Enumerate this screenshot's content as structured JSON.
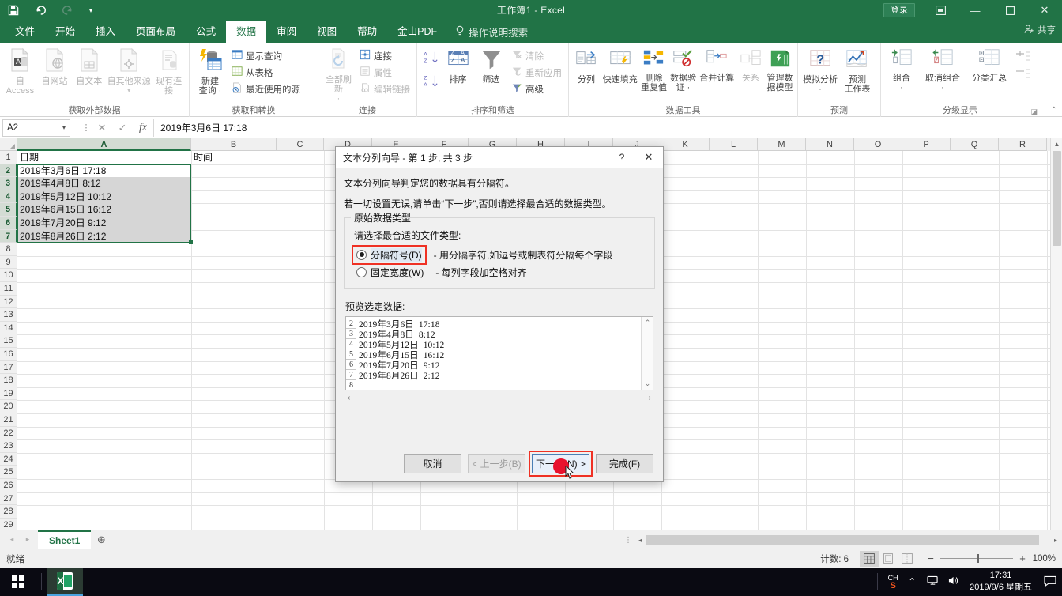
{
  "titlebar": {
    "document_title": "工作簿1  -  Excel",
    "quick_access": [
      {
        "name": "save",
        "glyph": "ὋE"
      },
      {
        "name": "undo",
        "glyph": "↶"
      },
      {
        "name": "redo",
        "glyph": "↷"
      },
      {
        "name": "customize",
        "glyph": "▾"
      }
    ],
    "sign_in_label": "登录",
    "ribbon_display_label": "⬜",
    "minimize_label": "—",
    "restore_label": "❐",
    "close_label": "✕",
    "share_label": "共享",
    "brand_color": "#217346"
  },
  "ribbon_tabs": [
    {
      "label": "文件",
      "active": false
    },
    {
      "label": "开始",
      "active": false
    },
    {
      "label": "插入",
      "active": false
    },
    {
      "label": "页面布局",
      "active": false
    },
    {
      "label": "公式",
      "active": false
    },
    {
      "label": "数据",
      "active": true
    },
    {
      "label": "审阅",
      "active": false
    },
    {
      "label": "视图",
      "active": false
    },
    {
      "label": "帮助",
      "active": false
    },
    {
      "label": "金山PDF",
      "active": false
    }
  ],
  "tell_me": "操作说明搜索",
  "ribbon_groups": [
    {
      "title": "获取外部数据",
      "big_buttons": [
        {
          "label": "自 Access",
          "icon": "access-icon",
          "disabled": true
        },
        {
          "label": "自网站",
          "icon": "web-icon",
          "disabled": true
        },
        {
          "label": "自文本",
          "icon": "text-file-icon",
          "disabled": true
        },
        {
          "label": "自其他来源",
          "icon": "other-sources-icon",
          "disabled": true
        },
        {
          "label": "现有连接",
          "icon": "existing-connections-icon",
          "disabled": true
        }
      ]
    },
    {
      "title": "获取和转换",
      "big_buttons": [
        {
          "label": "新建\n查询 ·",
          "icon": "new-query-icon",
          "disabled": false
        }
      ],
      "small_buttons": [
        {
          "label": "显示查询",
          "icon": "show-queries-icon",
          "disabled": false
        },
        {
          "label": "从表格",
          "icon": "from-table-icon",
          "disabled": false
        },
        {
          "label": "最近使用的源",
          "icon": "recent-sources-icon",
          "disabled": false
        }
      ]
    },
    {
      "title": "连接",
      "big_buttons": [
        {
          "label": "全部刷新\n·",
          "icon": "refresh-all-icon",
          "disabled": true
        }
      ],
      "small_buttons": [
        {
          "label": "连接",
          "icon": "connections-icon",
          "disabled": false
        },
        {
          "label": "属性",
          "icon": "properties-icon",
          "disabled": true
        },
        {
          "label": "编辑链接",
          "icon": "edit-links-icon",
          "disabled": true
        }
      ]
    },
    {
      "title": "排序和筛选",
      "big_buttons": [
        {
          "label": "排序",
          "icon": "sort-icon",
          "disabled": false
        },
        {
          "label": "筛选",
          "icon": "filter-icon",
          "disabled": false
        }
      ],
      "small_buttons": [
        {
          "label": "清除",
          "icon": "clear-filter-icon",
          "disabled": true
        },
        {
          "label": "重新应用",
          "icon": "reapply-icon",
          "disabled": true
        },
        {
          "label": "高级",
          "icon": "advanced-filter-icon",
          "disabled": false
        }
      ],
      "sort_az_label": "A↓Z",
      "sort_za_label": "Z↓A"
    },
    {
      "title": "数据工具",
      "big_buttons": [
        {
          "label": "分列",
          "icon": "text-to-columns-icon",
          "disabled": false
        },
        {
          "label": "快速填充",
          "icon": "flash-fill-icon",
          "disabled": false
        },
        {
          "label": "删除\n重复值",
          "icon": "remove-duplicates-icon",
          "disabled": false
        },
        {
          "label": "数据验\n证 ·",
          "icon": "data-validation-icon",
          "disabled": false
        },
        {
          "label": "合并计算",
          "icon": "consolidate-icon",
          "disabled": false
        },
        {
          "label": "关系",
          "icon": "relationships-icon",
          "disabled": true
        },
        {
          "label": "管理数\n据模型",
          "icon": "manage-data-model-icon",
          "disabled": false
        }
      ]
    },
    {
      "title": "预测",
      "big_buttons": [
        {
          "label": "模拟分析\n·",
          "icon": "what-if-analysis-icon",
          "disabled": false
        },
        {
          "label": "预测\n工作表",
          "icon": "forecast-sheet-icon",
          "disabled": false
        }
      ]
    },
    {
      "title": "分级显示",
      "big_buttons": [
        {
          "label": "组合\n·",
          "icon": "group-icon",
          "disabled": false
        },
        {
          "label": "取消组合\n·",
          "icon": "ungroup-icon",
          "disabled": false
        },
        {
          "label": "分类汇总",
          "icon": "subtotal-icon",
          "disabled": false
        }
      ]
    }
  ],
  "formula_bar": {
    "name_box_value": "A2",
    "cancel_label": "✕",
    "enter_label": "✓",
    "fx_label": "fx",
    "formula_value": "2019年3月6日 17:18"
  },
  "grid": {
    "column_headers": [
      "A",
      "B",
      "C",
      "D",
      "E",
      "F",
      "G",
      "H",
      "I",
      "J",
      "K",
      "L",
      "M",
      "N",
      "O",
      "P",
      "Q",
      "R"
    ],
    "selected_column": "A",
    "row_numbers": [
      1,
      2,
      3,
      4,
      5,
      6,
      7,
      8,
      9,
      10,
      11,
      12,
      13,
      14,
      15,
      16,
      17,
      18,
      19,
      20,
      21,
      22,
      23,
      24,
      25,
      26,
      27,
      28,
      29
    ],
    "selected_rows": [
      2,
      3,
      4,
      5,
      6,
      7
    ],
    "cells": [
      {
        "ref": "A1",
        "col": 0,
        "row": 1,
        "value": "日期",
        "shaded": false
      },
      {
        "ref": "B1",
        "col": 1,
        "row": 1,
        "value": "时间",
        "shaded": false
      },
      {
        "ref": "A2",
        "col": 0,
        "row": 2,
        "value": "2019年3月6日 17:18",
        "shaded": false
      },
      {
        "ref": "A3",
        "col": 0,
        "row": 3,
        "value": "2019年4月8日 8:12",
        "shaded": true
      },
      {
        "ref": "A4",
        "col": 0,
        "row": 4,
        "value": "2019年5月12日 10:12",
        "shaded": true
      },
      {
        "ref": "A5",
        "col": 0,
        "row": 5,
        "value": "2019年6月15日 16:12",
        "shaded": true
      },
      {
        "ref": "A6",
        "col": 0,
        "row": 6,
        "value": "2019年7月20日 9:12",
        "shaded": true
      },
      {
        "ref": "A7",
        "col": 0,
        "row": 7,
        "value": "2019年8月26日 2:12",
        "shaded": true
      }
    ]
  },
  "sheet_tabs": {
    "nav_first": "◂",
    "nav_last": "▸",
    "tabs": [
      {
        "label": "Sheet1",
        "active": true
      }
    ],
    "add_sheet_label": "⊕"
  },
  "status_bar": {
    "mode": "就绪",
    "count_label": "计数: 6",
    "views": [
      {
        "name": "normal-view",
        "active": true
      },
      {
        "name": "page-layout-view",
        "active": false
      },
      {
        "name": "page-break-view",
        "active": false
      }
    ],
    "zoom_out_label": "−",
    "zoom_in_label": "+",
    "zoom_level": "100%"
  },
  "taskbar": {
    "start_label": "start-button",
    "apps": [
      {
        "name": "excel",
        "label": "Excel",
        "active": true
      }
    ],
    "ime_lang": "CH",
    "ime_engine": "S",
    "tray_icons": [
      "∧",
      "὚5",
      "ὐA"
    ],
    "clock_time": "17:31",
    "clock_date": "2019/9/6 星期五",
    "action_center_label": "὞8"
  },
  "dialog": {
    "title": "文本分列向导 - 第 1 步, 共 3 步",
    "help_label": "?",
    "close_label": "✕",
    "line1": "文本分列向导判定您的数据具有分隔符。",
    "line2": "若一切设置无误,请单击“下一步”,否则请选择最合适的数据类型。",
    "fieldset_legend": "原始数据类型",
    "prompt": "请选择最合适的文件类型:",
    "options": [
      {
        "label": "分隔符号(D)",
        "accel": "D",
        "description": "- 用分隔字符,如逗号或制表符分隔每个字段",
        "selected": true,
        "highlighted": true
      },
      {
        "label": "固定宽度(W)",
        "accel": "W",
        "description": "- 每列字段加空格对齐",
        "selected": false,
        "highlighted": false
      }
    ],
    "preview_label": "预览选定数据:",
    "preview_rows": [
      {
        "num": "2",
        "text": "2019年3月6日  17:18"
      },
      {
        "num": "3",
        "text": "2019年4月8日  8:12"
      },
      {
        "num": "4",
        "text": "2019年5月12日  10:12"
      },
      {
        "num": "5",
        "text": "2019年6月15日  16:12"
      },
      {
        "num": "6",
        "text": "2019年7月20日  9:12"
      },
      {
        "num": "7",
        "text": "2019年8月26日  2:12"
      },
      {
        "num": "8",
        "text": ""
      }
    ],
    "buttons": [
      {
        "label": "取消",
        "state": "normal",
        "highlighted": false
      },
      {
        "label": "< 上一步(B)",
        "state": "disabled",
        "highlighted": false
      },
      {
        "label": "下一步(N) >",
        "state": "default",
        "highlighted": true
      },
      {
        "label": "完成(F)",
        "state": "normal",
        "highlighted": false
      }
    ],
    "highlight_color": "#ef3124",
    "cursor_color": "#e8112d"
  }
}
